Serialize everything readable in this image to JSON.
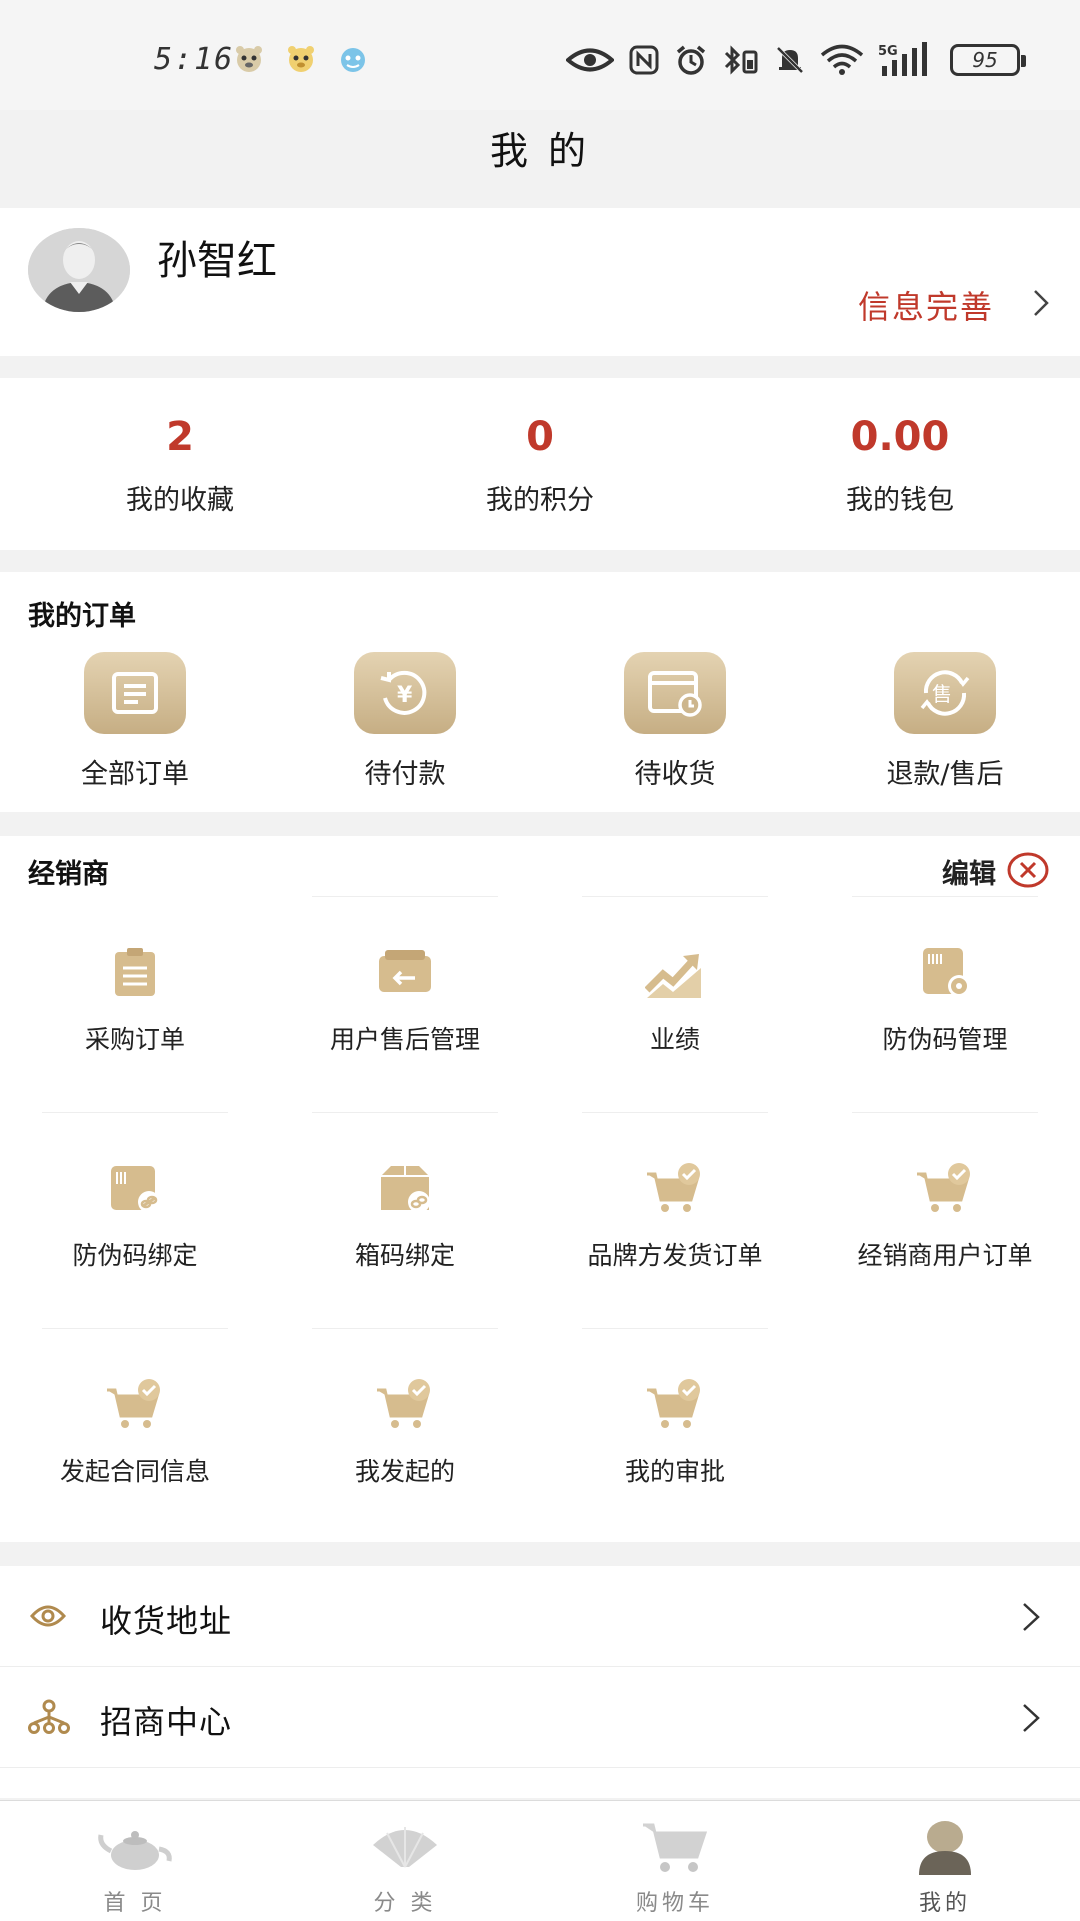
{
  "status_bar": {
    "time": "5:16",
    "network": "5G",
    "battery": "95"
  },
  "header": {
    "title": "我 的"
  },
  "profile": {
    "name": "孙智红",
    "info_link": "信息完善"
  },
  "stats": [
    {
      "value": "2",
      "label": "我的收藏"
    },
    {
      "value": "0",
      "label": "我的积分"
    },
    {
      "value": "0.00",
      "label": "我的钱包"
    }
  ],
  "orders": {
    "title": "我的订单",
    "items": [
      {
        "label": "全部订单",
        "icon": "order-list-icon"
      },
      {
        "label": "待付款",
        "icon": "pending-payment-icon"
      },
      {
        "label": "待收货",
        "icon": "pending-receipt-icon"
      },
      {
        "label": "退款/售后",
        "icon": "after-sale-icon"
      }
    ]
  },
  "dealer": {
    "title": "经销商",
    "edit_label": "编辑",
    "items": [
      {
        "label": "采购订单",
        "icon": "clipboard-icon"
      },
      {
        "label": "用户售后管理",
        "icon": "return-box-icon"
      },
      {
        "label": "业绩",
        "icon": "trend-chart-icon"
      },
      {
        "label": "防伪码管理",
        "icon": "barcode-gear-icon"
      },
      {
        "label": "防伪码绑定",
        "icon": "barcode-link-icon"
      },
      {
        "label": "箱码绑定",
        "icon": "box-link-icon"
      },
      {
        "label": "品牌方发货订单",
        "icon": "cart-check-icon"
      },
      {
        "label": "经销商用户订单",
        "icon": "cart-check-icon"
      },
      {
        "label": "发起合同信息",
        "icon": "cart-check-icon"
      },
      {
        "label": "我发起的",
        "icon": "cart-check-icon"
      },
      {
        "label": "我的审批",
        "icon": "cart-check-icon"
      }
    ]
  },
  "menu": [
    {
      "label": "收货地址",
      "icon": "location-icon"
    },
    {
      "label": "招商中心",
      "icon": "network-icon"
    }
  ],
  "tabbar": [
    {
      "label": "首 页",
      "icon": "teapot-icon"
    },
    {
      "label": "分 类",
      "icon": "fan-icon"
    },
    {
      "label": "购物车",
      "icon": "cart-icon"
    },
    {
      "label": "我的",
      "icon": "profile-icon"
    }
  ],
  "colors": {
    "accent_red": "#c0392b",
    "gold": "#d2b88c",
    "background": "#f2f2f2"
  }
}
